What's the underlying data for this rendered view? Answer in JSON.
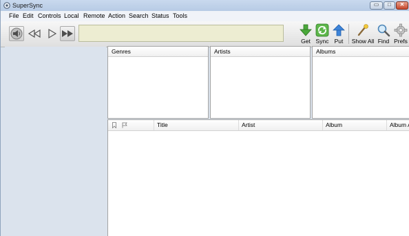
{
  "window": {
    "title": "SuperSync",
    "buttons": {
      "minimize": "▭",
      "maximize": "□",
      "close": "✕"
    }
  },
  "menu": [
    "File",
    "Edit",
    "Controls",
    "Local",
    "Remote",
    "Action",
    "Search",
    "Status",
    "Tools"
  ],
  "transport": {
    "icons": [
      "speaker-icon",
      "previous-icon",
      "play-icon",
      "next-icon"
    ]
  },
  "display": {
    "text": ""
  },
  "tools": {
    "get": {
      "label": "Get",
      "icon": "down-arrow-icon",
      "color": "#3f9b2a"
    },
    "sync": {
      "label": "Sync",
      "icon": "sync-icon",
      "color": "#4f9a3a"
    },
    "put": {
      "label": "Put",
      "icon": "up-arrow-icon",
      "color": "#3a7bd5"
    },
    "show_all": {
      "label": "Show All",
      "icon": "wand-icon"
    },
    "find": {
      "label": "Find",
      "icon": "magnifier-icon"
    },
    "prefs": {
      "label": "Prefs",
      "icon": "gear-icon"
    }
  },
  "browser": {
    "genres": "Genres",
    "artists": "Artists",
    "albums": "Albums"
  },
  "tracks": {
    "columns": [
      "Title",
      "Artist",
      "Album",
      "Album A"
    ],
    "rows": []
  },
  "colors": {
    "sidebar": "#dbe3ed",
    "display": "#ededd2",
    "titlebar": "#c1d3ea"
  }
}
